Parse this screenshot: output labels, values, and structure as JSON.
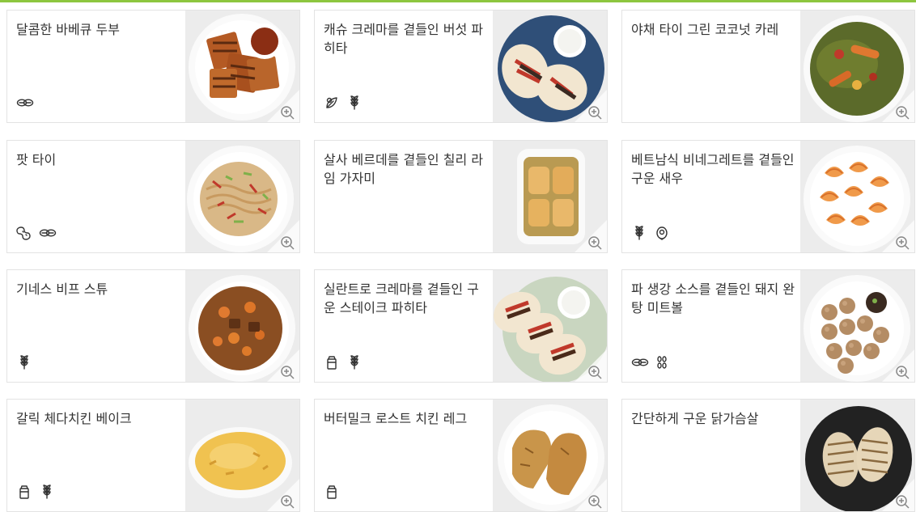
{
  "colors": {
    "accent": "#8dc63f",
    "border": "#e3e3e3",
    "text": "#333333"
  },
  "cards": [
    {
      "title": "달콤한 바베큐 두부",
      "icons": [
        "tofu-icon"
      ],
      "image": "grilled-tofu-bbq-sauce"
    },
    {
      "title": "캐슈 크레마를 곁들인 버섯 파히타",
      "icons": [
        "plant-icon",
        "wheat-icon"
      ],
      "image": "mushroom-fajitas"
    },
    {
      "title": "야채 타이 그린 코코넛 카레",
      "icons": [],
      "image": "green-curry"
    },
    {
      "title": "팟 타이",
      "icons": [
        "peanut-icon",
        "tofu-icon"
      ],
      "image": "pad-thai"
    },
    {
      "title": "살사 베르데를 곁들인 칠리 라임 가자미",
      "icons": [],
      "image": "baked-fish-dish"
    },
    {
      "title": "베트남식 비네그레트를 곁들인 구운 새우",
      "icons": [
        "wheat-icon",
        "fish-icon"
      ],
      "image": "roasted-shrimp"
    },
    {
      "title": "기네스 비프 스튜",
      "icons": [
        "wheat-icon"
      ],
      "image": "beef-stew"
    },
    {
      "title": "실란트로 크레마를 곁들인 구운 스테이크 파히타",
      "icons": [
        "milk-icon",
        "wheat-icon"
      ],
      "image": "steak-fajitas"
    },
    {
      "title": "파 생강 소스를 곁들인 돼지 완탕 미트볼",
      "icons": [
        "tofu-icon",
        "sesame-icon"
      ],
      "image": "pork-meatballs"
    },
    {
      "title": "갈릭 체다치킨 베이크",
      "icons": [
        "milk-icon",
        "wheat-icon"
      ],
      "image": "chicken-bake"
    },
    {
      "title": "버터밀크 로스트 치킨 레그",
      "icons": [
        "milk-icon"
      ],
      "image": "roast-chicken-legs"
    },
    {
      "title": "간단하게 구운 닭가슴살",
      "icons": [],
      "image": "grilled-chicken-breast"
    }
  ]
}
